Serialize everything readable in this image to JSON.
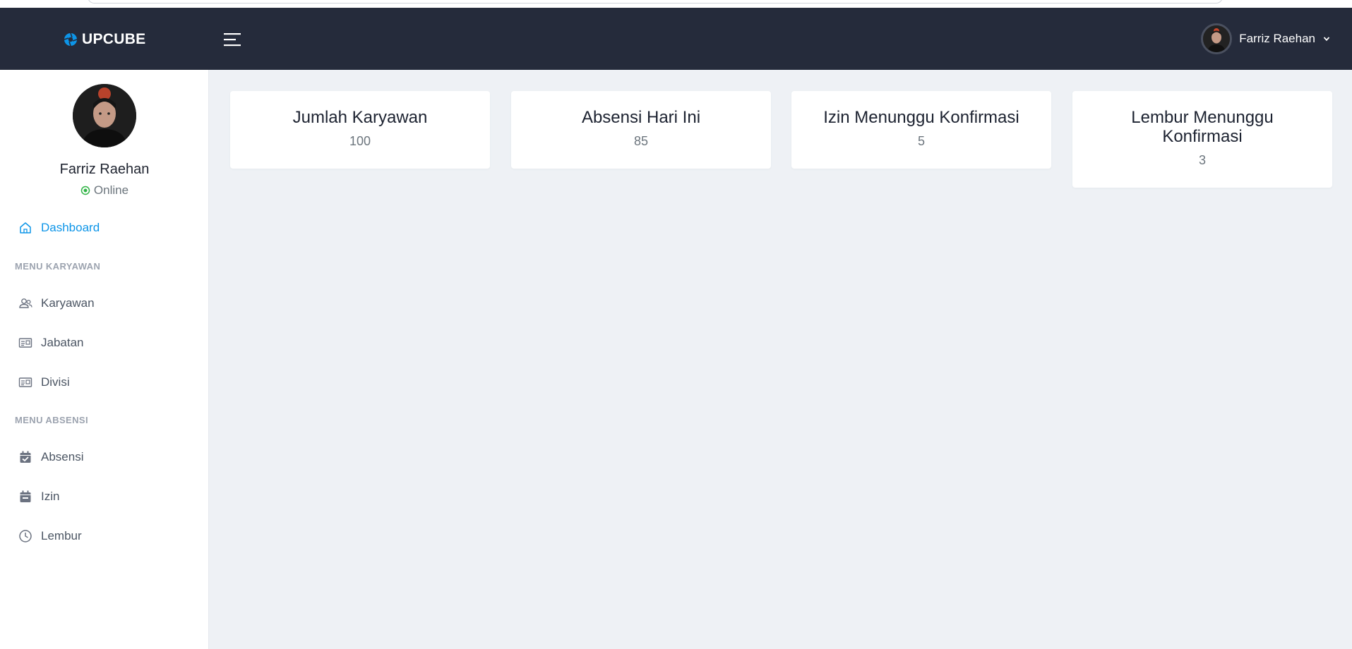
{
  "app": {
    "brand_name": "UPCUBE",
    "brand_color": "#0d95e8"
  },
  "header": {
    "menu_icon": "hamburger-icon",
    "user_name": "Farriz Raehan",
    "caret_icon": "chevron-down-icon"
  },
  "sidebar": {
    "profile": {
      "name": "Farriz Raehan",
      "status": "Online",
      "status_color": "#2fb344"
    },
    "dashboard": {
      "label": "Dashboard",
      "icon": "home-icon"
    },
    "section_karyawan": "MENU KARYAWAN",
    "karyawan_items": [
      {
        "label": "Karyawan",
        "icon": "users-icon"
      },
      {
        "label": "Jabatan",
        "icon": "id-card-icon"
      },
      {
        "label": "Divisi",
        "icon": "id-card-icon"
      }
    ],
    "section_absensi": "MENU ABSENSI",
    "absensi_items": [
      {
        "label": "Absensi",
        "icon": "calendar-check-icon"
      },
      {
        "label": "Izin",
        "icon": "calendar-icon"
      },
      {
        "label": "Lembur",
        "icon": "clock-icon"
      }
    ]
  },
  "cards": [
    {
      "title": "Jumlah Karyawan",
      "value": "100"
    },
    {
      "title": "Absensi Hari Ini",
      "value": "85"
    },
    {
      "title": "Izin Menunggu Konfirmasi",
      "value": "5"
    },
    {
      "title": "Lembur Menunggu Konfirmasi",
      "value": "3"
    }
  ]
}
